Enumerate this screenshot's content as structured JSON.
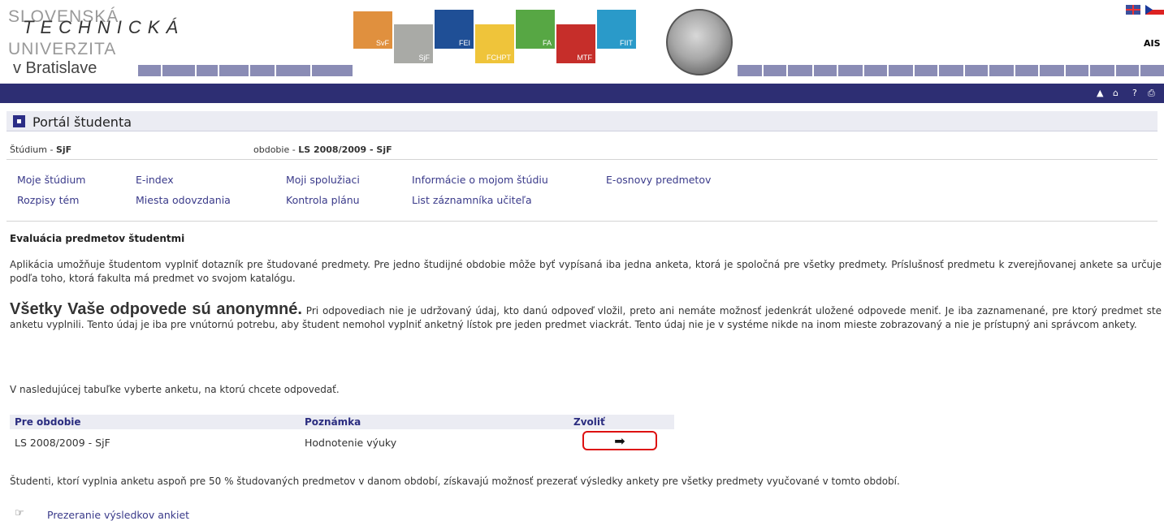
{
  "header": {
    "logo_lines": [
      "SLOVENSKÁ",
      "TECHNICKÁ",
      "UNIVERZITA",
      "v Bratislave"
    ],
    "faculties": [
      "SvF",
      "SjF",
      "FEI",
      "FCHPT",
      "FA",
      "MTF",
      "FIIT"
    ],
    "system_label": "AIS",
    "nav_icons": [
      "▲",
      "⌂",
      "?",
      "⎙"
    ]
  },
  "portal": {
    "title": "Portál študenta",
    "study_label": "Štúdium - ",
    "study_value": "SjF",
    "period_label": "obdobie - ",
    "period_value": "LS 2008/2009 - SjF"
  },
  "menu": {
    "row1": [
      "Moje štúdium",
      "E-index",
      "Moji spolužiaci",
      "Informácie o mojom štúdiu",
      "E-osnovy predmetov"
    ],
    "row2": [
      "Rozpisy tém",
      "Miesta odovzdania",
      "Kontrola plánu",
      "List záznamníka učiteľa"
    ]
  },
  "content": {
    "heading": "Evaluácia predmetov študentmi",
    "intro": "Aplikácia umožňuje študentom vyplniť dotazník pre študované predmety. Pre jedno študijné obdobie môže byť vypísaná iba jedna anketa, ktorá je spoločná pre všetky predmety. Príslušnosť predmetu k zverejňovanej ankete sa určuje podľa toho, ktorá fakulta má predmet vo svojom katalógu.",
    "anon_big": "Všetky Vaše odpovede sú anonymné.",
    "anon_text": " Pri odpovediach nie je udržovaný údaj, kto danú odpoveď vložil, preto ani nemáte možnosť jedenkrát uložené odpovede meniť. Je iba zaznamenané, pre ktorý predmet ste anketu vyplnili. Tento údaj je iba pre vnútornú potrebu, aby študent nemohol vyplniť anketný lístok pre jeden predmet viackrát. Tento údaj nie je v systéme nikde na inom mieste zobrazovaný a nie je prístupný ani správcom ankety.",
    "select_text": "V nasledujúcej tabuľke vyberte anketu, na ktorú chcete odpovedať.",
    "table": {
      "headers": [
        "Pre obdobie",
        "Poznámka",
        "Zvoliť"
      ],
      "rows": [
        {
          "period": "LS 2008/2009 - SjF",
          "note": "Hodnotenie výuky",
          "action_icon": "➡"
        }
      ]
    },
    "footer_text": "Študenti, ktorí vyplnia anketu aspoň pre 50 % študovaných predmetov v danom období, získavajú možnosť prezerať výsledky ankety pre všetky predmety vyučované v tomto období.",
    "results_link": "Prezeranie výsledkov ankiet",
    "results_icon": "☞"
  },
  "colors": {
    "navbar": "#2d2e73",
    "link": "#3a3a8a",
    "highlight_border": "#d11"
  }
}
